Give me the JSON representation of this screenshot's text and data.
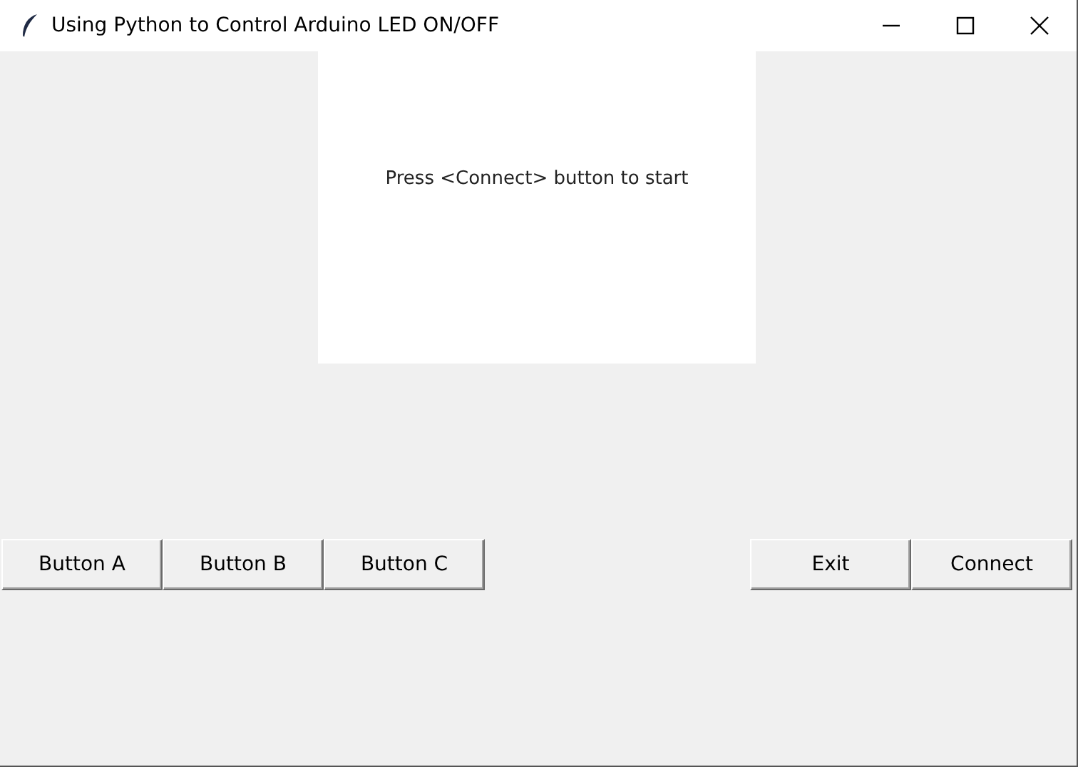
{
  "window": {
    "title": "Using Python to Control Arduino LED ON/OFF"
  },
  "message": "Press <Connect> button to start",
  "left_buttons": [
    "Button A",
    "Button B",
    "Button C"
  ],
  "right_buttons": [
    "Exit",
    "Connect"
  ]
}
